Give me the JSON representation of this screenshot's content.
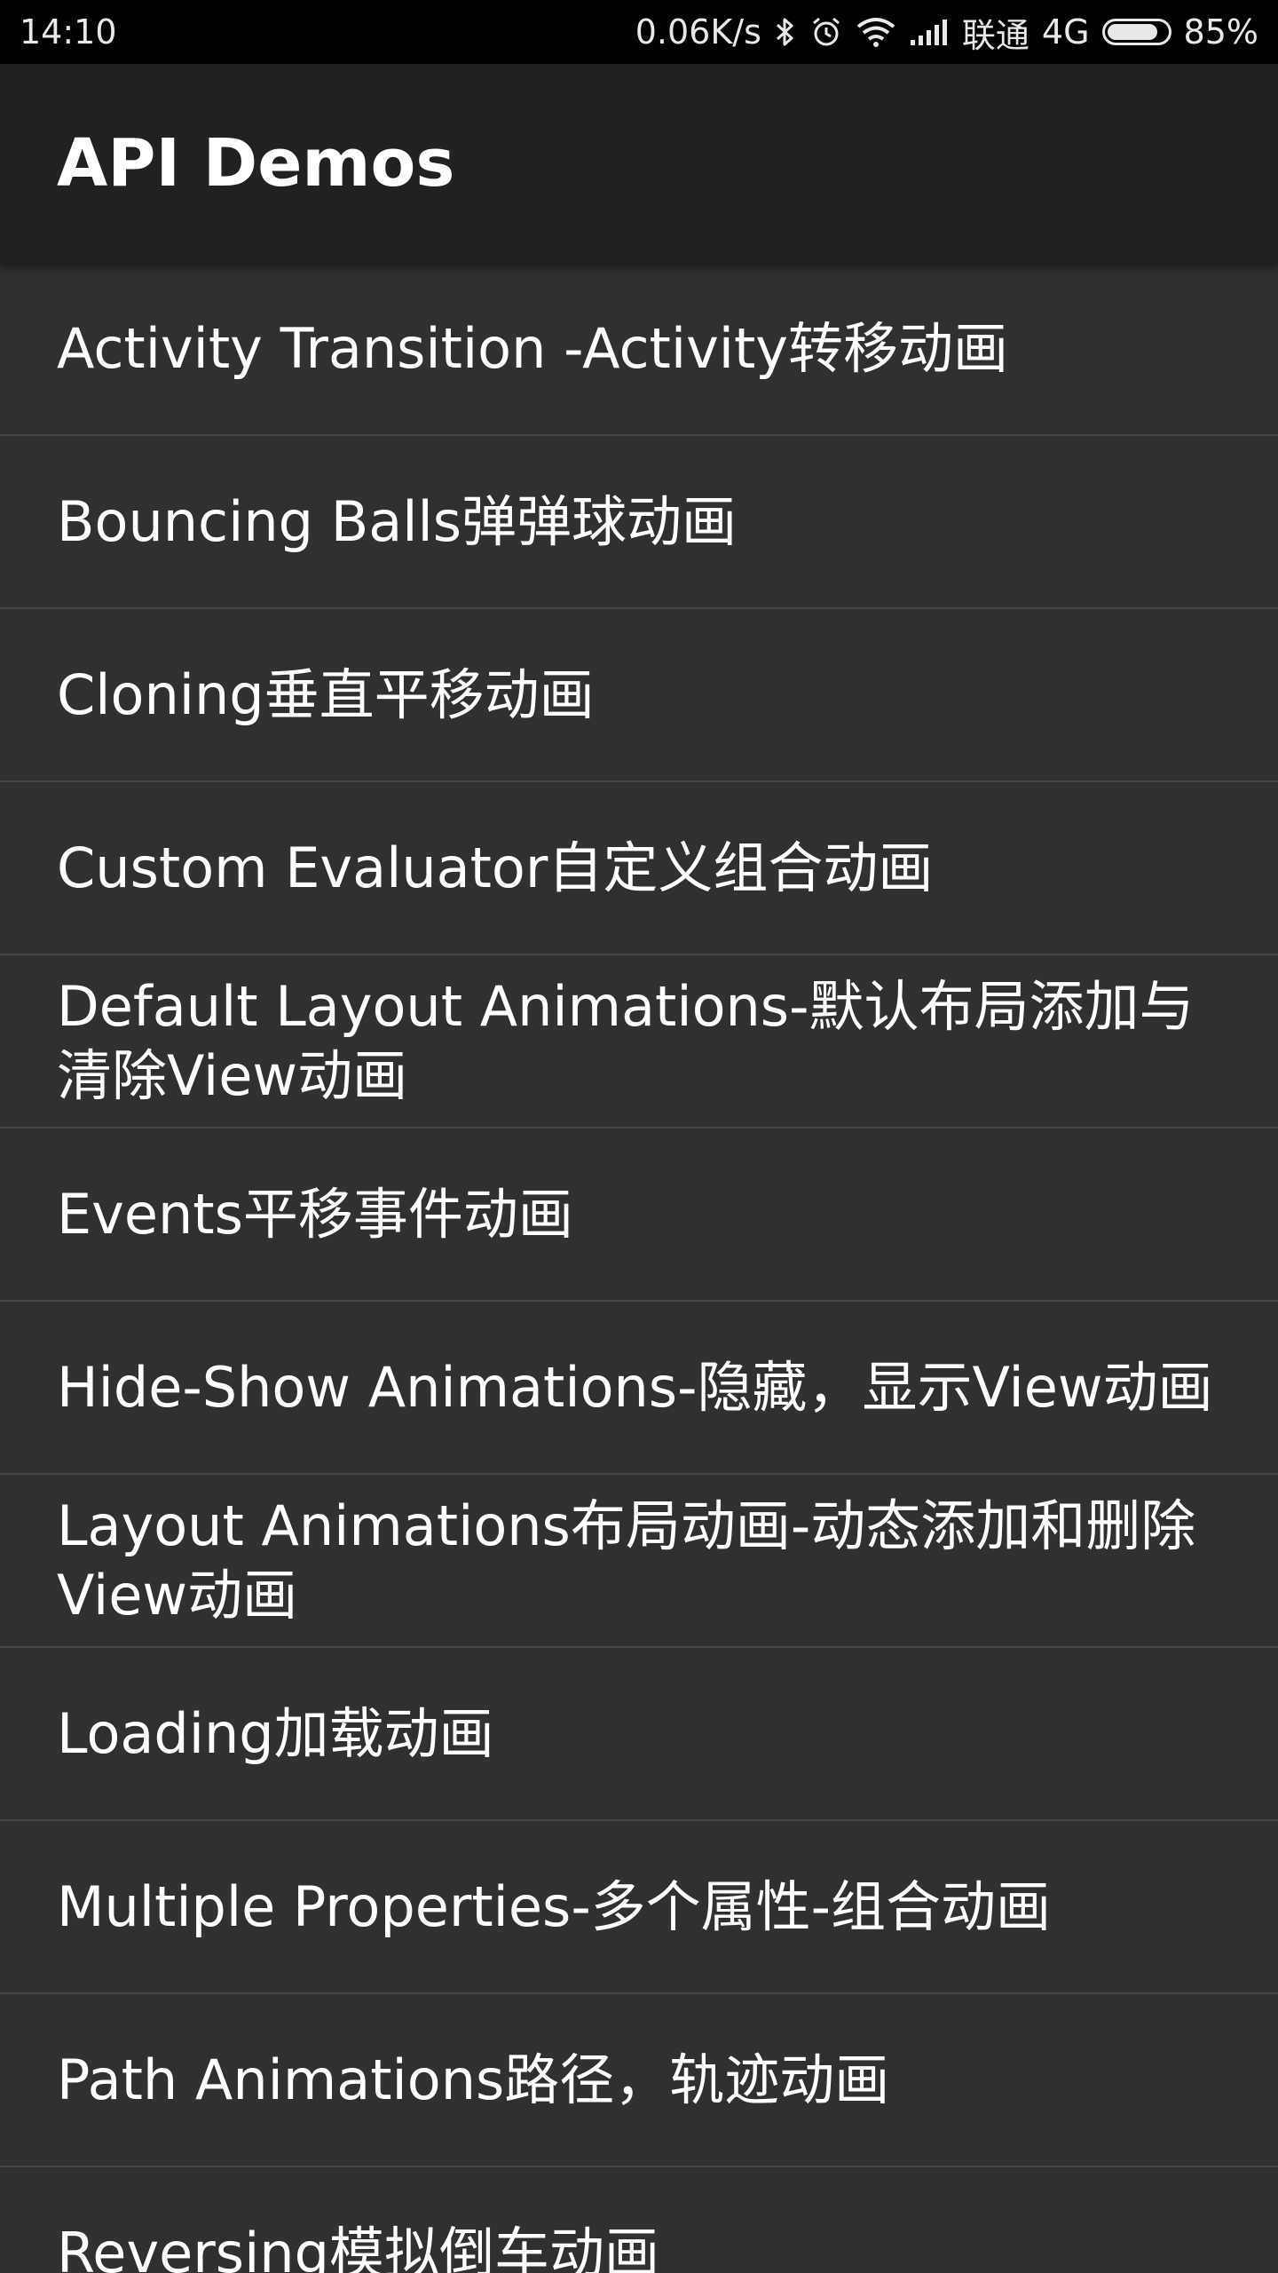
{
  "status_bar": {
    "time": "14:10",
    "network_speed": "0.06K/s",
    "carrier": "联通",
    "network_type": "4G",
    "battery_percent": "85%",
    "battery_level": 0.85,
    "icons": [
      "bluetooth-icon",
      "alarm-icon",
      "wifi-icon",
      "signal-icon",
      "battery-icon"
    ]
  },
  "app_bar": {
    "title": "API Demos"
  },
  "list": {
    "items": [
      {
        "label": "Activity Transition -Activity转移动画"
      },
      {
        "label": "Bouncing Balls弹弹球动画"
      },
      {
        "label": "Cloning垂直平移动画"
      },
      {
        "label": "Custom Evaluator自定义组合动画"
      },
      {
        "label": "Default Layout Animations-默认布局添加与清除View动画"
      },
      {
        "label": "Events平移事件动画"
      },
      {
        "label": "Hide-Show Animations-隐藏，显示View动画"
      },
      {
        "label": "Layout Animations布局动画-动态添加和删除View动画"
      },
      {
        "label": "Loading加载动画"
      },
      {
        "label": "Multiple Properties-多个属性-组合动画"
      },
      {
        "label": "Path Animations路径，轨迹动画"
      },
      {
        "label": "Reversing模拟倒车动画"
      }
    ]
  },
  "colors": {
    "status_bar_bg": "#000000",
    "app_bar_bg": "#212121",
    "list_bg": "#303030",
    "divider": "#474747",
    "text": "#ffffff"
  }
}
